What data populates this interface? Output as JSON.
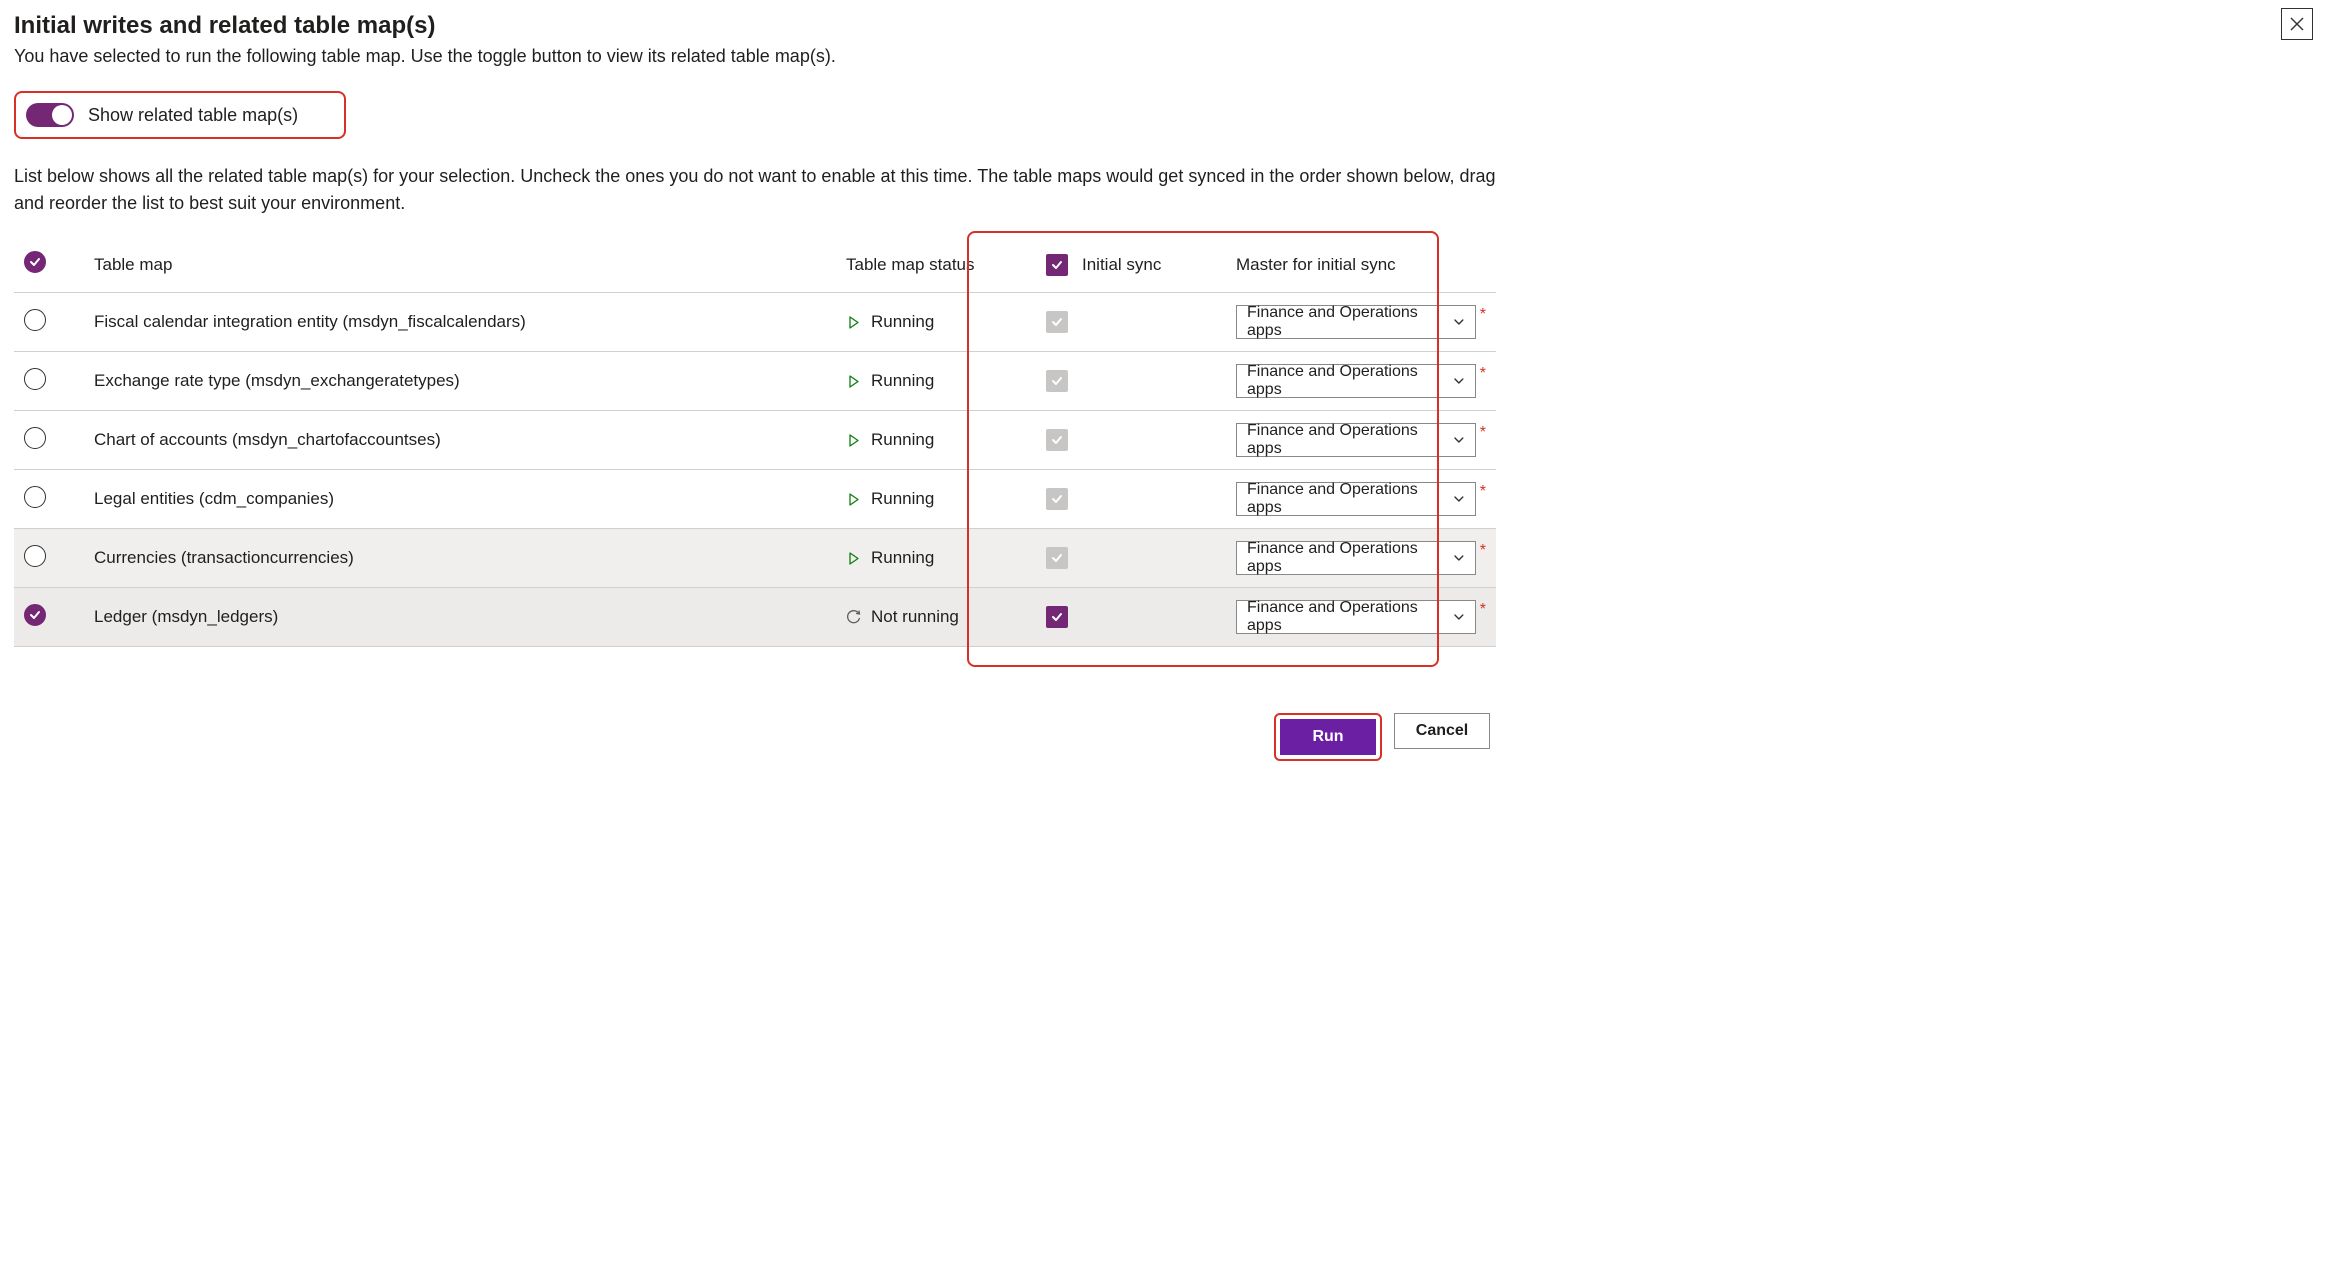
{
  "header": {
    "title": "Initial writes and related table map(s)",
    "intro": "You have selected to run the following table map. Use the toggle button to view its related table map(s).",
    "toggle_label": "Show related table map(s)",
    "description": "List below shows all the related table map(s) for your selection. Uncheck the ones you do not want to enable at this time. The table maps would get synced in the order shown below, drag and reorder the list to best suit your environment."
  },
  "columns": {
    "table_map": "Table map",
    "status": "Table map status",
    "initial_sync": "Initial sync",
    "master": "Master for initial sync"
  },
  "status_labels": {
    "running": "Running",
    "not_running": "Not running"
  },
  "master_option": "Finance and Operations apps",
  "rows": [
    {
      "name": "Fiscal calendar integration entity (msdyn_fiscalcalendars)",
      "status": "running",
      "selected": false,
      "sync_enabled": false,
      "alt": false
    },
    {
      "name": "Exchange rate type (msdyn_exchangeratetypes)",
      "status": "running",
      "selected": false,
      "sync_enabled": false,
      "alt": false
    },
    {
      "name": "Chart of accounts (msdyn_chartofaccountses)",
      "status": "running",
      "selected": false,
      "sync_enabled": false,
      "alt": false
    },
    {
      "name": "Legal entities (cdm_companies)",
      "status": "running",
      "selected": false,
      "sync_enabled": false,
      "alt": false
    },
    {
      "name": "Currencies (transactioncurrencies)",
      "status": "running",
      "selected": false,
      "sync_enabled": false,
      "alt": true
    },
    {
      "name": "Ledger (msdyn_ledgers)",
      "status": "not_running",
      "selected": true,
      "sync_enabled": true,
      "alt": true
    }
  ],
  "footer": {
    "run": "Run",
    "cancel": "Cancel"
  }
}
